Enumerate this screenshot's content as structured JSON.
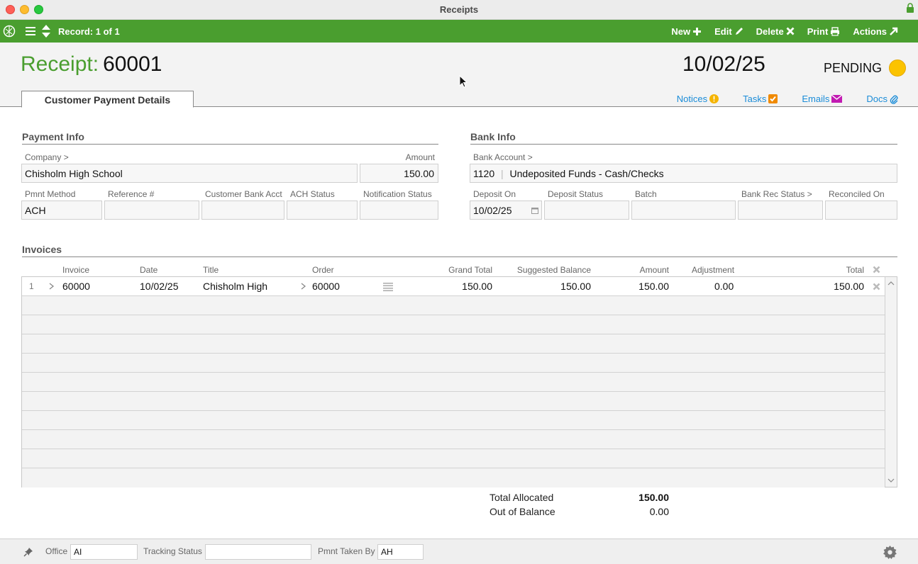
{
  "window": {
    "title": "Receipts"
  },
  "toolbar": {
    "record": "Record: 1 of 1",
    "new": "New",
    "edit": "Edit",
    "delete": "Delete",
    "print": "Print",
    "actions": "Actions"
  },
  "header": {
    "receipt_label": "Receipt:",
    "receipt_number": "60001",
    "date": "10/02/25",
    "status": "PENDING",
    "status_color": "#fbc300",
    "tab": "Customer Payment Details",
    "links": {
      "notices": "Notices",
      "tasks": "Tasks",
      "emails": "Emails",
      "docs": "Docs"
    }
  },
  "payment_info": {
    "title": "Payment Info",
    "company_label": "Company >",
    "company": "Chisholm High School",
    "amount_label": "Amount",
    "amount": "150.00",
    "method_label": "Pmnt Method",
    "method": "ACH",
    "reference_label": "Reference #",
    "reference": "",
    "cust_bank_label": "Customer Bank Acct",
    "cust_bank": "",
    "ach_status_label": "ACH Status",
    "ach_status": "",
    "notif_label": "Notification Status",
    "notif": ""
  },
  "bank_info": {
    "title": "Bank Info",
    "account_label": "Bank Account >",
    "account_code": "1120",
    "account_name": "Undeposited Funds - Cash/Checks",
    "deposit_on_label": "Deposit On",
    "deposit_on": "10/02/25",
    "deposit_status_label": "Deposit Status",
    "deposit_status": "",
    "batch_label": "Batch",
    "batch": "",
    "bank_rec_label": "Bank Rec Status >",
    "bank_rec": "",
    "reconciled_label": "Reconciled On",
    "reconciled": ""
  },
  "invoices": {
    "title": "Invoices",
    "columns": {
      "invoice": "Invoice",
      "date": "Date",
      "title": "Title",
      "order": "Order",
      "grand_total": "Grand Total",
      "suggested": "Suggested Balance",
      "amount": "Amount",
      "adjustment": "Adjustment",
      "total": "Total"
    },
    "rows": [
      {
        "num": "1",
        "invoice": "60000",
        "date": "10/02/25",
        "title": "Chisholm High",
        "order": "60000",
        "grand_total": "150.00",
        "suggested": "150.00",
        "amount": "150.00",
        "adjustment": "0.00",
        "total": "150.00"
      }
    ]
  },
  "totals": {
    "allocated_label": "Total Allocated",
    "allocated": "150.00",
    "oob_label": "Out of Balance",
    "oob": "0.00"
  },
  "footer": {
    "office_label": "Office",
    "office": "AI",
    "tracking_label": "Tracking Status",
    "tracking": "",
    "taken_by_label": "Pmnt Taken By",
    "taken_by": "AH"
  },
  "icons": [
    "lock-icon",
    "app-logo-icon",
    "list-icon",
    "sort-arrows-icon",
    "plus-icon",
    "pencil-icon",
    "x-icon",
    "printer-icon",
    "arrow-out-icon",
    "exclamation-icon",
    "check-icon",
    "envelope-icon",
    "paperclip-icon",
    "calendar-icon",
    "chevron-right-icon",
    "list-lines-icon",
    "pin-icon",
    "gear-icon"
  ]
}
